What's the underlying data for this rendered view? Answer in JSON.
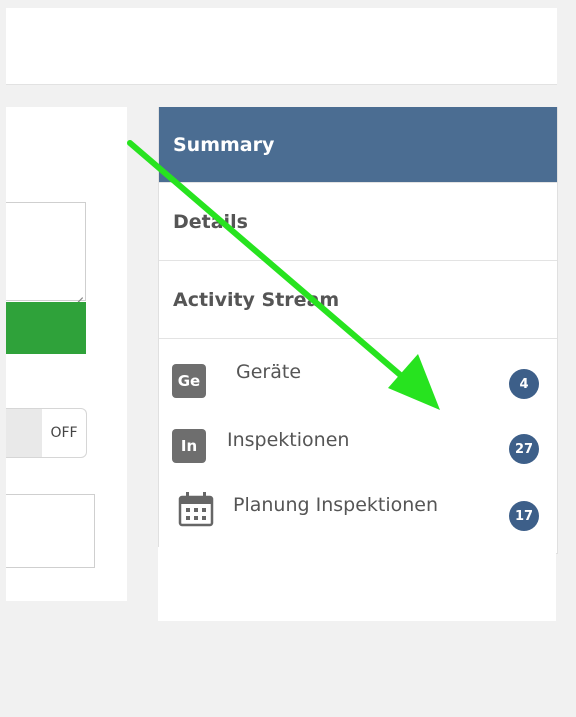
{
  "colors": {
    "active_tab": "#4b6d92",
    "badge": "#3d5f89",
    "green_button": "#2fa23a",
    "annotation_arrow": "#27e31f"
  },
  "form": {
    "toggle_off_label": "OFF"
  },
  "side_menu": {
    "tabs": [
      {
        "label": "Summary",
        "active": true
      },
      {
        "label": "Details",
        "active": false
      },
      {
        "label": "Activity Stream",
        "active": false
      }
    ],
    "links": [
      {
        "icon_text": "Ge",
        "label": "Geräte",
        "count": "4"
      },
      {
        "icon_text": "In",
        "label": "Inspektionen",
        "count": "27"
      },
      {
        "icon": "calendar-icon",
        "label": "Planung Inspektionen",
        "count": "17"
      }
    ]
  }
}
